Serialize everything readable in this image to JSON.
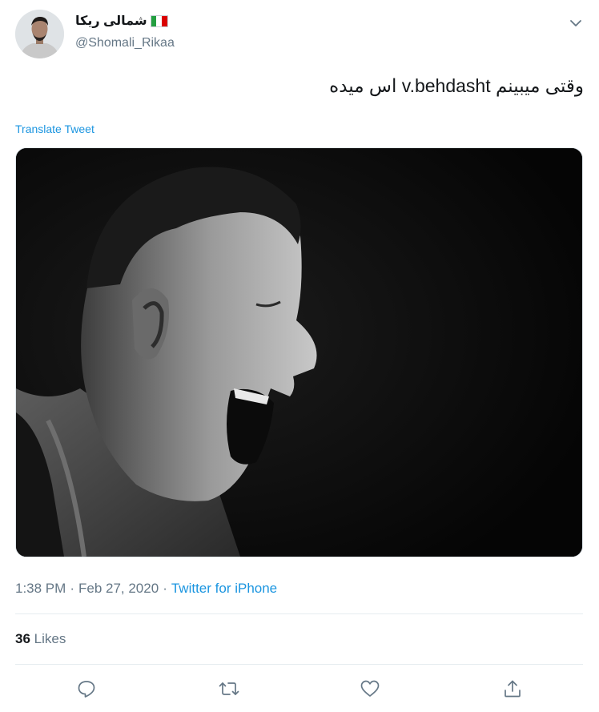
{
  "author": {
    "display_name": "شمالی ریکا",
    "handle": "@Shomali_Rikaa",
    "flag_colors": [
      "#239f40",
      "#ffffff",
      "#da0000"
    ],
    "avatar_icon": "user-photo"
  },
  "tweet": {
    "text": "وقتی میبینم v.behdasht اس میده",
    "translate_label": "Translate Tweet"
  },
  "media": {
    "description_icon": "photo-screaming-man"
  },
  "meta": {
    "time": "1:38 PM",
    "separator": "·",
    "date": "Feb 27, 2020",
    "source": "Twitter for iPhone"
  },
  "stats": {
    "likes_count": "36",
    "likes_label": "Likes"
  },
  "actions": {
    "reply_icon": "reply-icon",
    "retweet_icon": "retweet-icon",
    "like_icon": "like-icon",
    "share_icon": "share-icon"
  },
  "colors": {
    "link": "#1b95e0",
    "secondary_text": "#657786",
    "primary_text": "#14171a",
    "icon": "#657786"
  }
}
